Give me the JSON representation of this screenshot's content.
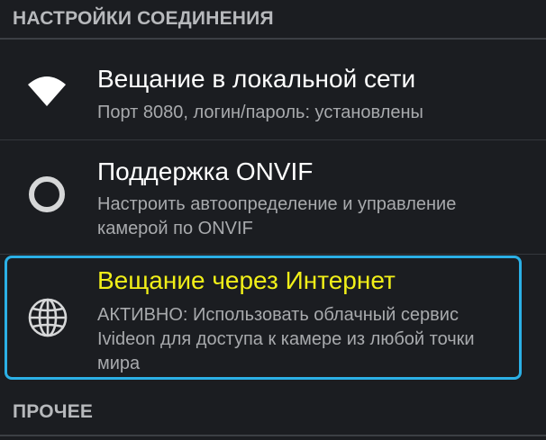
{
  "sections": {
    "connection": "НАСТРОЙКИ СОЕДИНЕНИЯ",
    "other": "ПРОЧЕЕ"
  },
  "items": [
    {
      "icon": "wifi-icon",
      "title": "Вещание в локальной сети",
      "summary": "Порт 8080, логин/пароль: установлены"
    },
    {
      "icon": "circle-icon",
      "title": "Поддержка ONVIF",
      "summary": "Настроить автоопределение и управление камерой по ONVIF"
    },
    {
      "icon": "globe-icon",
      "title": "Вещание через Интернет",
      "summary": "АКТИВНО: Использовать облачный сервис Ivideon для доступа к камере из любой точки мира"
    }
  ],
  "colors": {
    "background": "#1b1d21",
    "highlight_border": "#2bb0e6",
    "highlight_title": "#f1ef18"
  }
}
